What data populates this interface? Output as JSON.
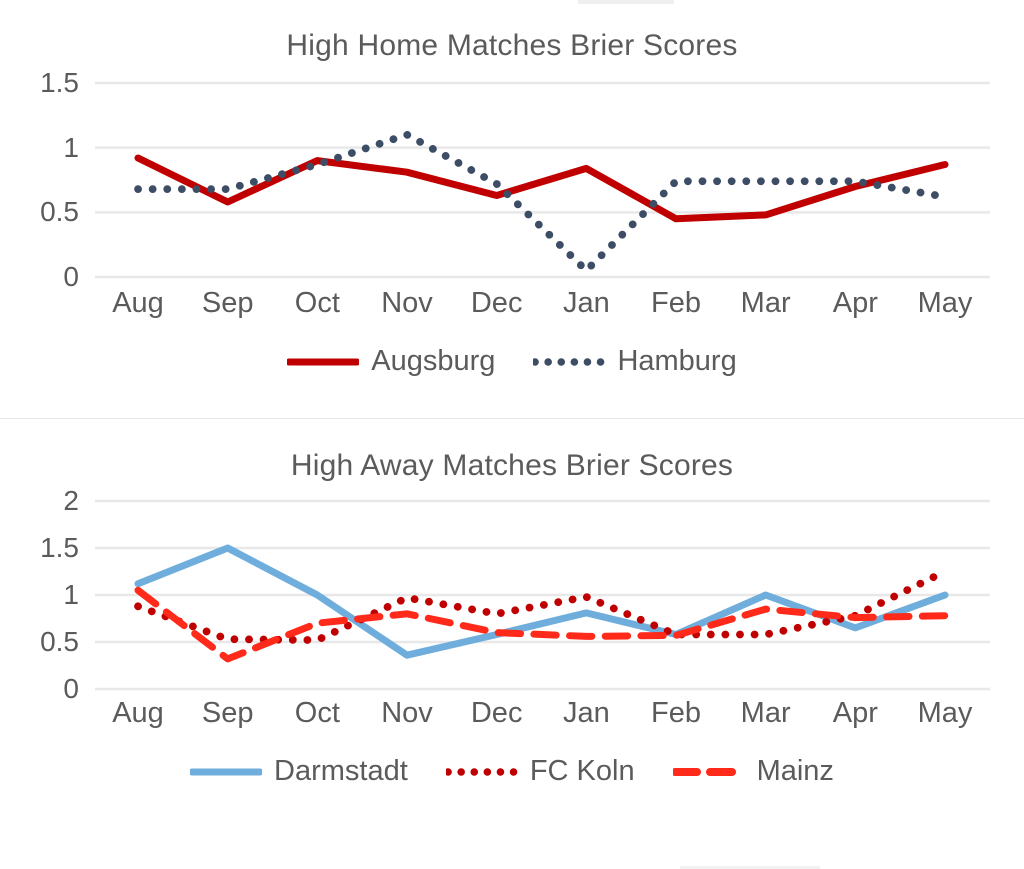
{
  "colors": {
    "augsburg": "#C00000",
    "hamburg": "#3D4D66",
    "darmstadt": "#6FAEDC",
    "fc_koln": "#C00000",
    "mainz": "#FF2A1A",
    "gridline": "#E8E8E8",
    "text": "#5B5B5B",
    "background": "#FFFFFF"
  },
  "charts": [
    {
      "id": "home",
      "title": "High Home Matches Brier Scores",
      "legend_position": "bottom"
    },
    {
      "id": "away",
      "title": "High Away Matches Brier Scores",
      "legend_position": "bottom"
    }
  ],
  "chart_data": [
    {
      "type": "line",
      "title": "High Home Matches Brier Scores",
      "xlabel": "",
      "ylabel": "",
      "categories": [
        "Aug",
        "Sep",
        "Oct",
        "Nov",
        "Dec",
        "Jan",
        "Feb",
        "Mar",
        "Apr",
        "May"
      ],
      "ylim": [
        0,
        1.5
      ],
      "yticks": [
        0,
        0.5,
        1,
        1.5
      ],
      "ytick_labels": [
        "0",
        "0.5",
        "1",
        "1.5"
      ],
      "grid": true,
      "legend": [
        "Augsburg",
        "Hamburg"
      ],
      "series": [
        {
          "name": "Augsburg",
          "style": "solid",
          "color": "#C00000",
          "values": [
            0.92,
            0.58,
            0.9,
            0.81,
            0.63,
            0.84,
            0.45,
            0.48,
            0.7,
            0.87
          ]
        },
        {
          "name": "Hamburg",
          "style": "dotted",
          "color": "#3D4D66",
          "values": [
            0.68,
            0.68,
            0.87,
            1.1,
            0.72,
            0.05,
            0.74,
            0.74,
            0.74,
            0.62
          ]
        }
      ]
    },
    {
      "type": "line",
      "title": "High Away Matches Brier Scores",
      "xlabel": "",
      "ylabel": "",
      "categories": [
        "Aug",
        "Sep",
        "Oct",
        "Nov",
        "Dec",
        "Jan",
        "Feb",
        "Mar",
        "Apr",
        "May"
      ],
      "ylim": [
        0,
        2
      ],
      "yticks": [
        0,
        0.5,
        1,
        1.5,
        2
      ],
      "ytick_labels": [
        "0",
        "0.5",
        "1",
        "1.5",
        "2"
      ],
      "grid": true,
      "legend": [
        "Darmstadt",
        "FC Koln",
        "Mainz"
      ],
      "series": [
        {
          "name": "Darmstadt",
          "style": "solid",
          "color": "#6FAEDC",
          "values": [
            1.12,
            1.5,
            1.0,
            0.36,
            0.58,
            0.81,
            0.58,
            1.0,
            0.65,
            1.0
          ]
        },
        {
          "name": "FC Koln",
          "style": "dotted",
          "color": "#C00000",
          "values": [
            0.88,
            0.53,
            0.52,
            0.97,
            0.8,
            0.98,
            0.58,
            0.58,
            0.78,
            1.25
          ]
        },
        {
          "name": "Mainz",
          "style": "dashed",
          "color": "#FF2A1A",
          "values": [
            1.05,
            0.32,
            0.7,
            0.8,
            0.6,
            0.56,
            0.57,
            0.85,
            0.76,
            0.78
          ]
        }
      ]
    }
  ]
}
